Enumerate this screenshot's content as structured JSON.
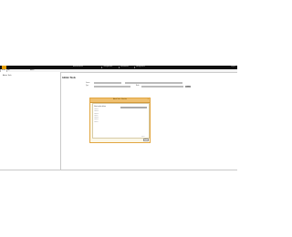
{
  "menubar": {
    "items": [
      "Administration",
      "Configuration",
      "Permissions",
      "Management"
    ],
    "right_label": "Logout"
  },
  "tabs": [
    "Home",
    "Edit",
    "Admin"
  ],
  "sidebar": {
    "item": "Admin Tools"
  },
  "main": {
    "page_title": "Admin Tools",
    "fields": [
      {
        "label": "Source",
        "value": "Value"
      },
      {
        "label": "Type",
        "value": ""
      },
      {
        "label": "Mode",
        "value": ""
      }
    ],
    "apply_label": "Apply"
  },
  "dialog": {
    "title": "Admin Tools - Selection",
    "close_label": "×",
    "panel_label": "Select option below",
    "select_value": "All",
    "list": [
      "Option 1",
      "Option 2",
      "Option 3",
      "Option 4",
      "Option 5",
      "Option 6",
      "Option 7"
    ],
    "footer_note": "Total 7",
    "ok_label": "OK"
  },
  "colors": {
    "accent": "#e2a640",
    "menubar": "#111111",
    "dialog_title": "#efc070"
  }
}
